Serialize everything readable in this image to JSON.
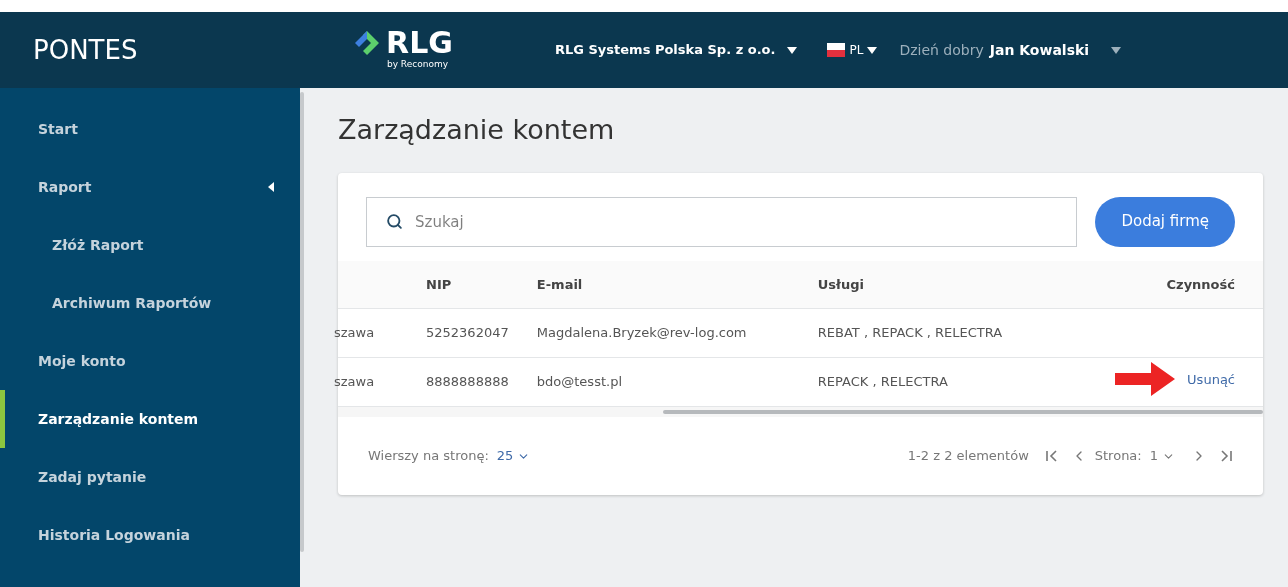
{
  "header": {
    "app_name": "PONTES",
    "logo": {
      "name": "RLG",
      "tagline": "by Reconomy"
    },
    "company": "RLG Systems Polska Sp. z o.o.",
    "language": "PL",
    "greeting": "Dzień dobry",
    "user": "Jan Kowalski"
  },
  "sidebar": {
    "items": [
      {
        "label": "Start",
        "selected": false
      },
      {
        "label": "Raport",
        "selected": false,
        "expanded": true,
        "children": [
          {
            "label": "Złóż Raport",
            "selected": false
          },
          {
            "label": "Archiwum Raportów",
            "selected": false
          }
        ]
      },
      {
        "label": "Moje konto",
        "selected": false
      },
      {
        "label": "Zarządzanie kontem",
        "selected": true
      },
      {
        "label": "Zadaj pytanie",
        "selected": false
      },
      {
        "label": "Historia Logowania",
        "selected": false
      }
    ]
  },
  "page_title": "Zarządzanie kontem",
  "search": {
    "placeholder": "Szukaj"
  },
  "add_button": "Dodaj firmę",
  "table": {
    "columns": [
      "",
      "NIP",
      "E-mail",
      "Usługi",
      "Czynność"
    ],
    "rows": [
      {
        "cells": [
          "szawa",
          "5252362047",
          "Magdalena.Bryzek@rev-log.com",
          "REBAT , REPACK , RELECTRA"
        ],
        "action": null
      },
      {
        "cells": [
          "szawa",
          "8888888888",
          "bdo@tesst.pl",
          "REPACK , RELECTRA"
        ],
        "action": "Usunąć"
      }
    ]
  },
  "pagination": {
    "rows_label": "Wierszy na stronę:",
    "rows_value": "25",
    "summary": "1-2 z 2 elementów",
    "page_label": "Strona:",
    "page_value": "1"
  }
}
